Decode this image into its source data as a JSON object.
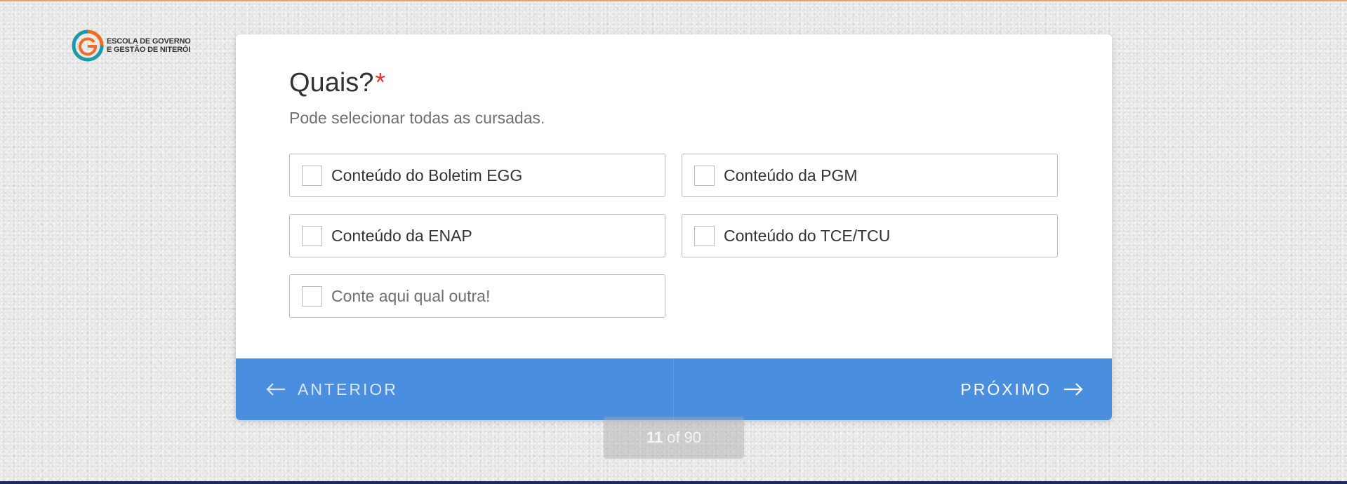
{
  "brand": {
    "logo_line1": "ESCOLA DE GOVERNO",
    "logo_line2": "E GESTÃO DE NITERÓI",
    "colors": {
      "teal": "#1b9aa8",
      "orange": "#f26b21"
    }
  },
  "question": {
    "title": "Quais?",
    "required_mark": "*",
    "helper": "Pode selecionar todas as cursadas."
  },
  "options": [
    {
      "label": "Conteúdo do Boletim EGG",
      "checked": false
    },
    {
      "label": "Conteúdo da PGM",
      "checked": false
    },
    {
      "label": "Conteúdo da ENAP",
      "checked": false
    },
    {
      "label": "Conteúdo do TCE/TCU",
      "checked": false
    }
  ],
  "other": {
    "placeholder": "Conte aqui qual outra!",
    "value": "",
    "checked": false
  },
  "navigation": {
    "prev_label": "ANTERIOR",
    "next_label": "PRÓXIMO",
    "prev_icon": "arrow-left-icon",
    "next_icon": "arrow-right-icon",
    "bar_color": "#4a8ee0"
  },
  "progress": {
    "current": "11",
    "of": "of",
    "total": "90"
  }
}
